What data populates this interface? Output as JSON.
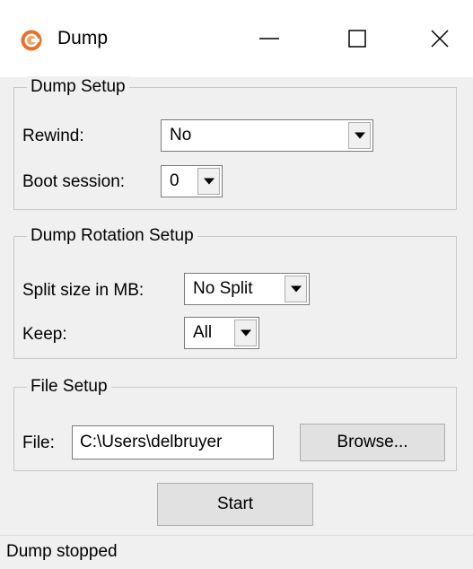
{
  "window": {
    "title": "Dump",
    "app_icon": "app-logo-icon",
    "controls": [
      "minimize-icon",
      "maximize-icon",
      "close-icon"
    ]
  },
  "dump_setup": {
    "title": "Dump Setup",
    "rewind": {
      "label": "Rewind:",
      "value": "No"
    },
    "boot_session": {
      "label": "Boot session:",
      "value": "0"
    }
  },
  "rotation_setup": {
    "title": "Dump Rotation Setup",
    "split_size": {
      "label": "Split size in MB:",
      "value": "No Split"
    },
    "keep": {
      "label": "Keep:",
      "value": "All"
    }
  },
  "file_setup": {
    "title": "File Setup",
    "file": {
      "label": "File:",
      "value": "C:\\Users\\delbruyer"
    },
    "browse_label": "Browse..."
  },
  "start_label": "Start",
  "status": "Dump stopped",
  "colors": {
    "accent": "#e8712a",
    "window_bg": "#f0f0f0",
    "titlebar_bg": "#ffffff"
  }
}
